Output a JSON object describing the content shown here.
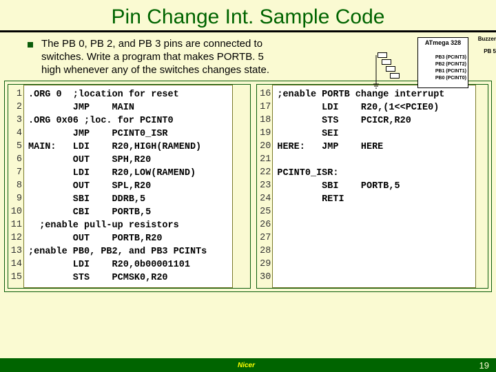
{
  "title": "Pin Change Int. Sample Code",
  "description": "The PB 0, PB 2, and PB 3 pins are connected to switches. Write a program that makes PORTB. 5 high whenever any of the switches changes state.",
  "diagram": {
    "chip": "ATmega 328",
    "out_pin": "PB 5",
    "buzzer": "Buzzer",
    "pins": "PB3 (PCINT3)\nPB2 (PCINT2)\nPB1 (PCINT1)\nPB0 (PCINT0)"
  },
  "code_left": {
    "nums": "1\n2\n3\n4\n5\n6\n7\n8\n9\n10\n11\n12\n13\n14\n15",
    "text": ".ORG 0  ;location for reset\n        JMP    MAIN\n.ORG 0x06 ;loc. for PCINT0\n        JMP    PCINT0_ISR\nMAIN:   LDI    R20,HIGH(RAMEND)\n        OUT    SPH,R20\n        LDI    R20,LOW(RAMEND)\n        OUT    SPL,R20\n        SBI    DDRB,5\n        CBI    PORTB,5\n  ;enable pull-up resistors\n        OUT    PORTB,R20\n;enable PB0, PB2, and PB3 PCINTs\n        LDI    R20,0b00001101\n        STS    PCMSK0,R20"
  },
  "code_right": {
    "nums": "16\n17\n18\n19\n20\n21\n22\n23\n24\n25\n26\n27\n28\n29\n30",
    "text": ";enable PORTB change interrupt\n        LDI    R20,(1<<PCIE0)\n        STS    PCICR,R20\n        SEI\nHERE:   JMP    HERE\n\nPCINT0_ISR:\n        SBI    PORTB,5\n        RETI\n\n\n\n\n\n"
  },
  "footer_logo": "Nicer",
  "page_number": "19"
}
